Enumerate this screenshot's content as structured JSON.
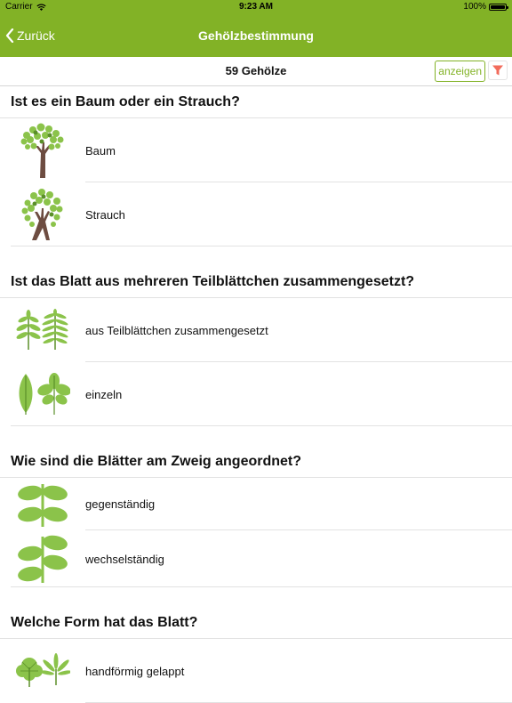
{
  "status_bar": {
    "carrier": "Carrier",
    "time": "9:23 AM",
    "battery": "100%",
    "battery_level": 1.0
  },
  "nav": {
    "back_label": "Zurück",
    "title": "Gehölzbestimmung"
  },
  "toolbar": {
    "count": "59 Gehölze",
    "show_button": "anzeigen"
  },
  "sections": [
    {
      "title": "Ist es ein Baum oder ein Strauch?",
      "options": [
        {
          "label": "Baum",
          "icon": "tree-icon"
        },
        {
          "label": "Strauch",
          "icon": "shrub-icon"
        }
      ]
    },
    {
      "title": "Ist das Blatt aus mehreren Teilblättchen zusammengesetzt?",
      "options": [
        {
          "label": "aus Teilblättchen zusammengesetzt",
          "icon": "compound-leaf-icon"
        },
        {
          "label": "einzeln",
          "icon": "single-leaf-icon"
        }
      ]
    },
    {
      "title": "Wie sind die Blätter am Zweig angeordnet?",
      "options": [
        {
          "label": "gegenständig",
          "icon": "opposite-leaves-icon"
        },
        {
          "label": "wechselständig",
          "icon": "alternate-leaves-icon"
        }
      ]
    },
    {
      "title": "Welche Form hat das Blatt?",
      "options": [
        {
          "label": "handförmig gelappt",
          "icon": "palmate-leaf-icon"
        }
      ]
    }
  ],
  "colors": {
    "accent": "#82b226",
    "leaf": "#8bc34a",
    "leaf_dark": "#5a8f29",
    "trunk": "#6d4c41",
    "filter": "#f26b5b"
  }
}
